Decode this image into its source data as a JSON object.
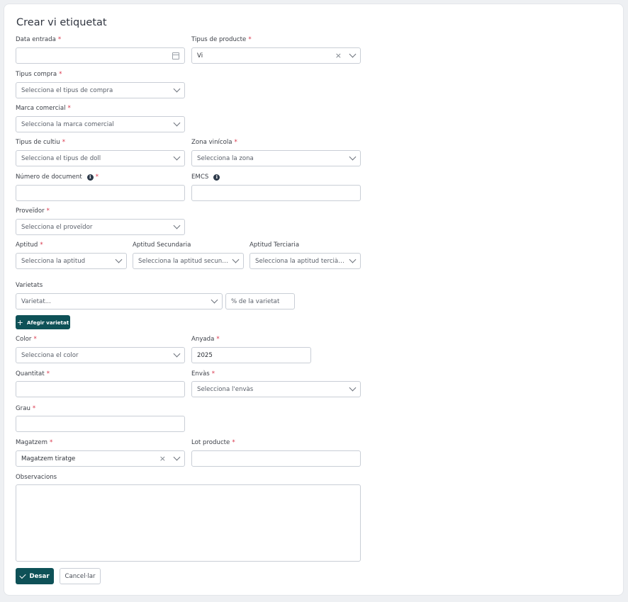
{
  "form": {
    "title": "Crear vi etiquetat",
    "required_mark": "*",
    "data_entrada": {
      "label": "Data entrada",
      "value": ""
    },
    "tipus_producte": {
      "label": "Tipus de producte",
      "value": "Vi"
    },
    "tipus_compra": {
      "label": "Tipus compra",
      "placeholder": "Selecciona el tipus de compra"
    },
    "marca_comercial": {
      "label": "Marca comercial",
      "placeholder": "Selecciona la marca comercial"
    },
    "tipus_cultiu": {
      "label": "Tipus de cultiu",
      "placeholder": "Selecciona el tipus de doll"
    },
    "zona_vinicola": {
      "label": "Zona vinícola",
      "placeholder": "Selecciona la zona"
    },
    "numero_document": {
      "label": "Número de document",
      "value": ""
    },
    "emcs": {
      "label": "EMCS",
      "value": ""
    },
    "proveidor": {
      "label": "Proveïdor",
      "placeholder": "Selecciona el proveïdor"
    },
    "aptitud": {
      "label": "Aptitud",
      "placeholder": "Selecciona la aptitud"
    },
    "aptitud_secundaria": {
      "label": "Aptitud Secundaria",
      "placeholder": "Selecciona la aptitud secundària"
    },
    "aptitud_terciaria": {
      "label": "Aptitud Terciaria",
      "placeholder": "Selecciona la aptitud terciària"
    },
    "varietats": {
      "label": "Varietats",
      "placeholder": "Varietat...",
      "percent_placeholder": "% de la varietat",
      "add_label": "Afegir varietat"
    },
    "color": {
      "label": "Color",
      "placeholder": "Selecciona el color"
    },
    "anyada": {
      "label": "Anyada",
      "value": "2025"
    },
    "quantitat": {
      "label": "Quantitat",
      "value": ""
    },
    "envas": {
      "label": "Envàs",
      "placeholder": "Selecciona l'envàs"
    },
    "grau": {
      "label": "Grau",
      "value": ""
    },
    "magatzem": {
      "label": "Magatzem",
      "value": "Magatzem tiratge"
    },
    "lot_producte": {
      "label": "Lot producte",
      "value": ""
    },
    "observacions": {
      "label": "Observacions",
      "value": ""
    },
    "actions": {
      "save_label": "Desar",
      "cancel_label": "Cancel·lar"
    }
  },
  "icons": {
    "calendar": "calendar-icon",
    "clear": "close-icon",
    "dropdown": "chevron-down-icon",
    "info": "info-icon",
    "plus": "plus-icon",
    "check": "check-icon"
  },
  "colors": {
    "primary": "#0e5157",
    "required": "#d9344a",
    "border": "#c9ced6"
  }
}
